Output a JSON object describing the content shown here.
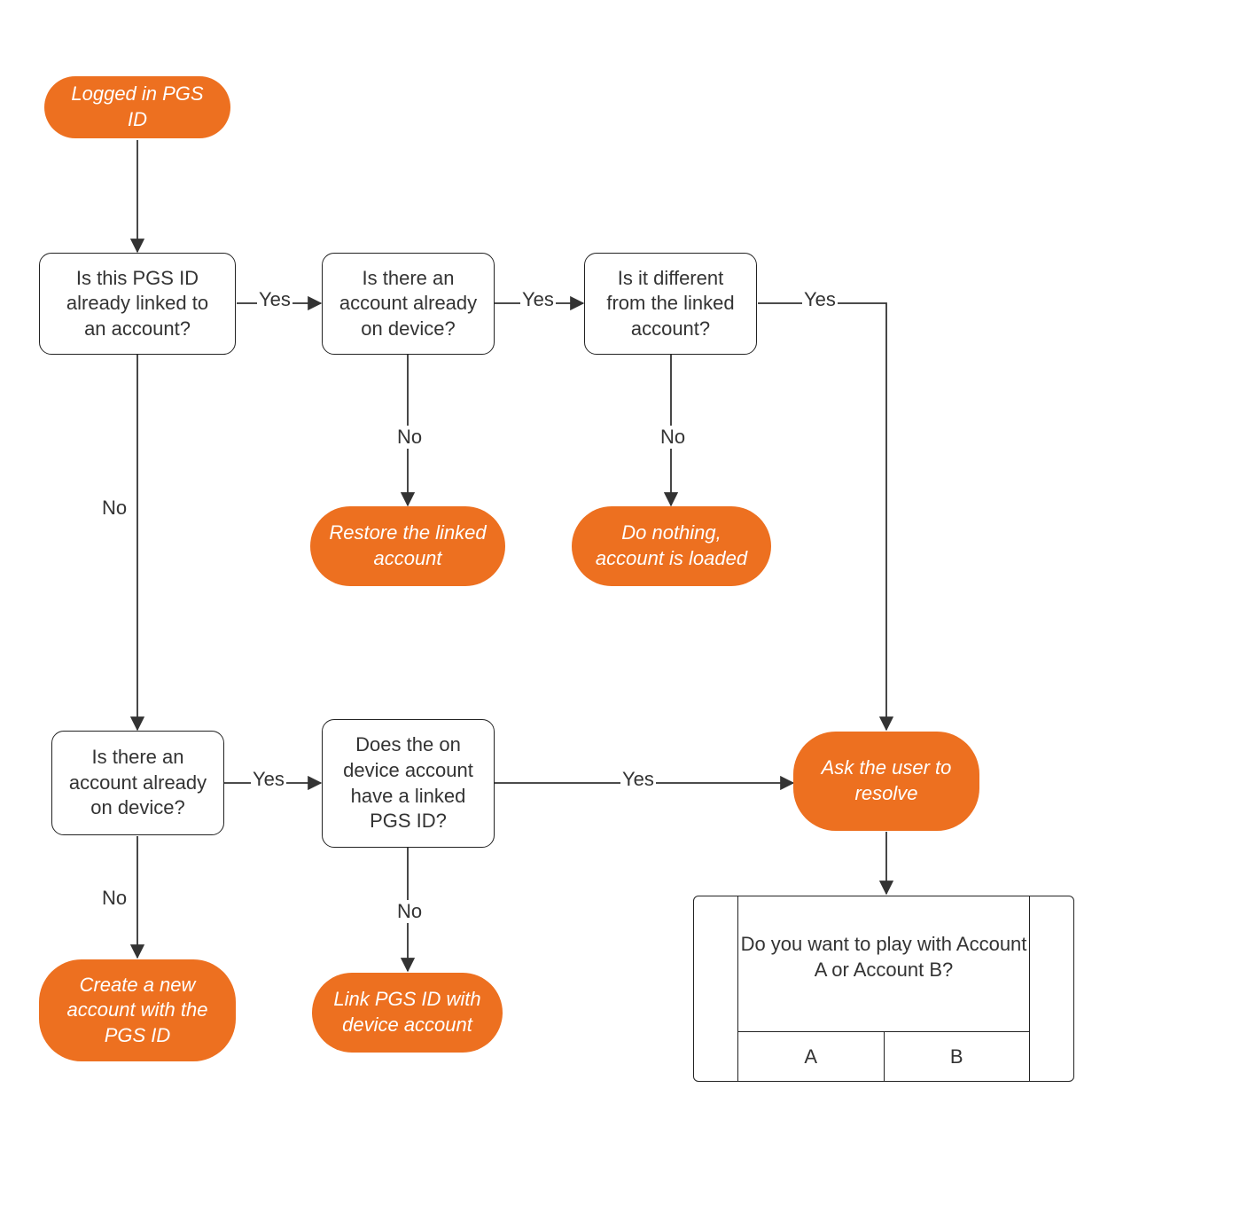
{
  "colors": {
    "accent": "#ed7020",
    "text": "#333333",
    "line": "#333333"
  },
  "nodes": {
    "start": "Logged in PGS ID",
    "q_linked": "Is this PGS ID already linked to an account?",
    "q_on_device_1": "Is there an account already on device?",
    "q_different": "Is it different from the linked account?",
    "restore": "Restore the linked account",
    "do_nothing": "Do nothing, account is loaded",
    "q_on_device_2": "Is there an account already on device?",
    "q_device_has_pgs": "Does the on device account have a linked PGS ID?",
    "ask_resolve": "Ask the user to resolve",
    "create_new": "Create a new account with the PGS  ID",
    "link_pgs": "Link PGS ID with device account"
  },
  "edges": {
    "yes": "Yes",
    "no": "No"
  },
  "dialog": {
    "prompt": "Do you want to play with Account A or Account B?",
    "option_a": "A",
    "option_b": "B"
  }
}
